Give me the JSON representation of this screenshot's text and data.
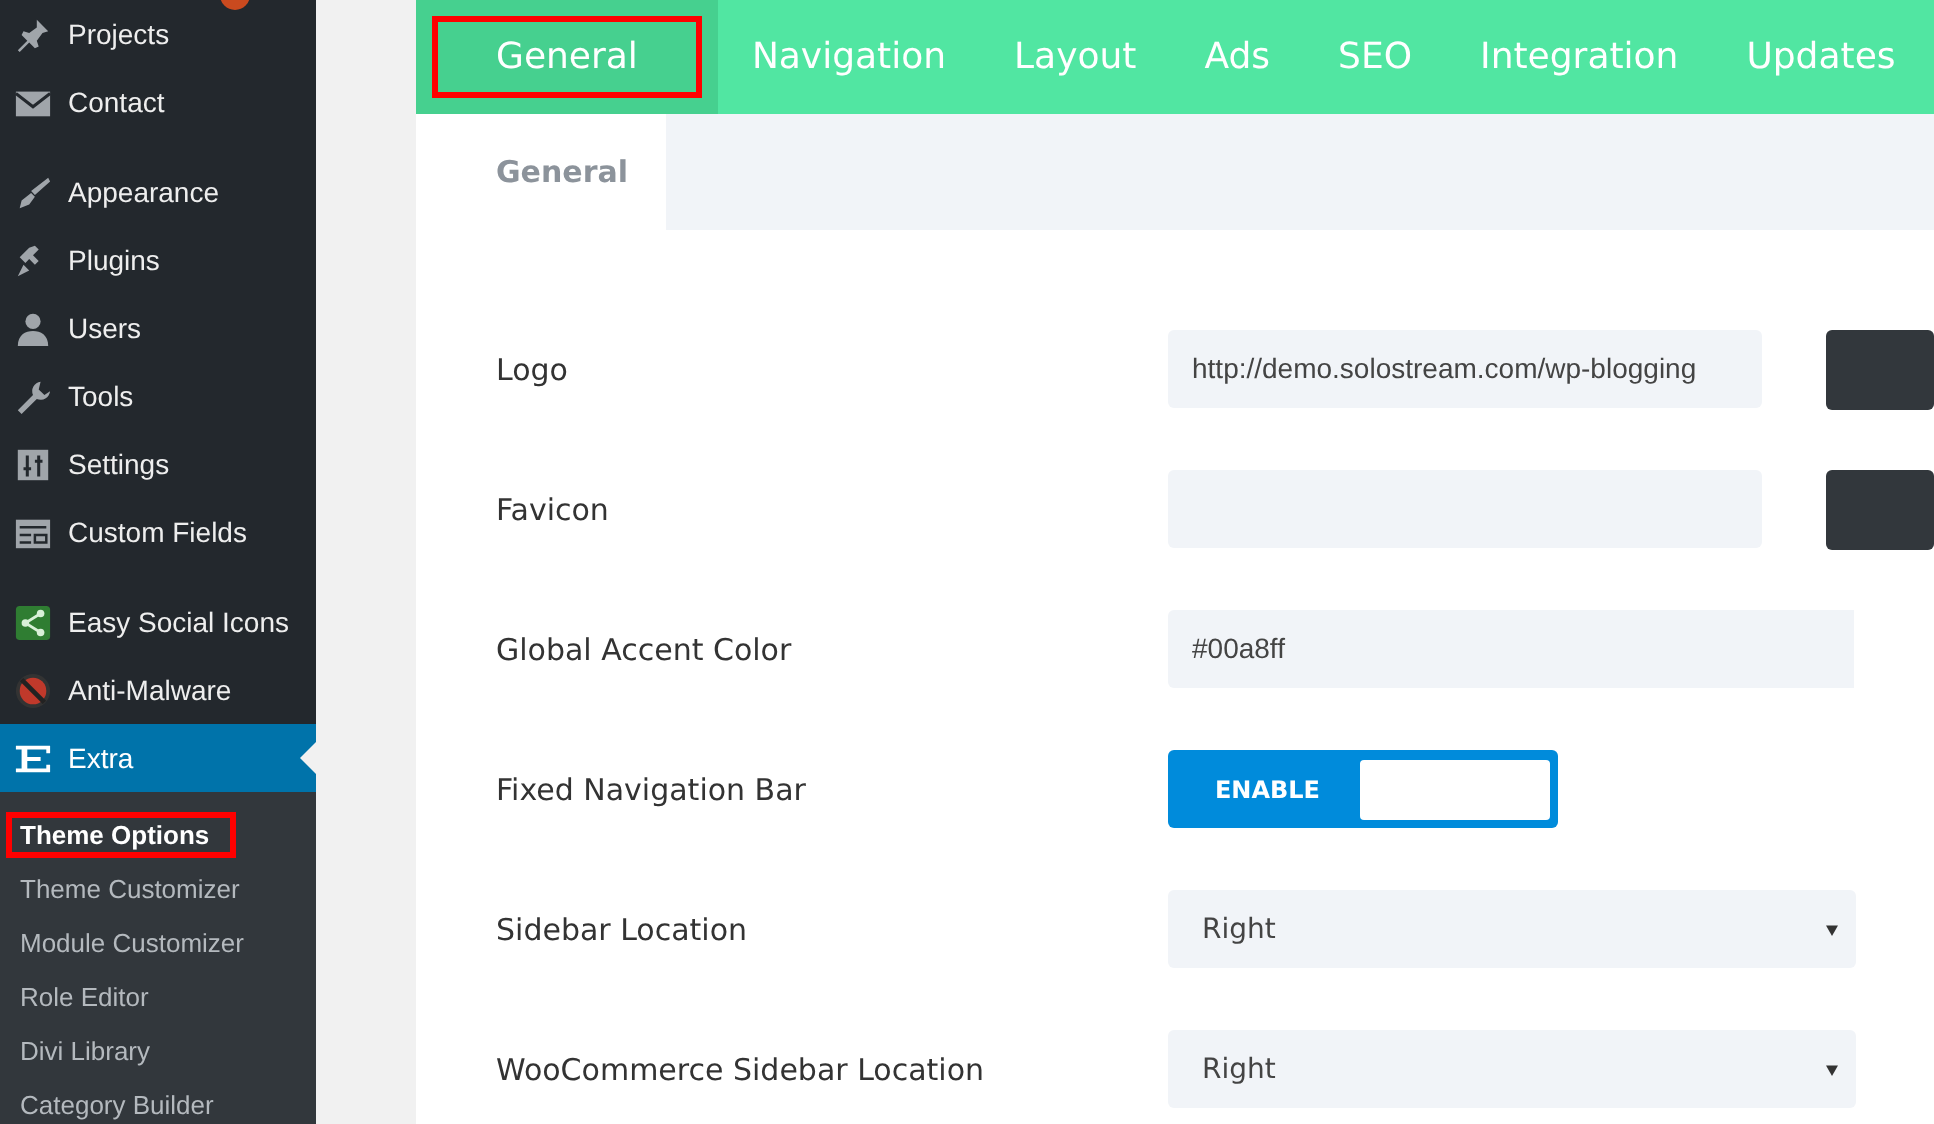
{
  "sidebar": {
    "badge": true,
    "groups": [
      {
        "items": [
          {
            "label": "Projects",
            "selected": false
          },
          {
            "label": "Contact",
            "selected": false
          }
        ]
      },
      {
        "items": [
          {
            "label": "Appearance",
            "selected": false
          },
          {
            "label": "Plugins",
            "selected": false
          },
          {
            "label": "Users",
            "selected": false
          },
          {
            "label": "Tools",
            "selected": false
          },
          {
            "label": "Settings",
            "selected": false
          },
          {
            "label": "Custom Fields",
            "selected": false
          }
        ]
      },
      {
        "items": [
          {
            "label": "Easy Social Icons",
            "selected": false
          },
          {
            "label": "Anti-Malware",
            "selected": false
          },
          {
            "label": "Extra",
            "selected": true,
            "children": [
              {
                "label": "Theme Options",
                "selected": true,
                "highlighted": true
              },
              {
                "label": "Theme Customizer",
                "selected": false,
                "highlighted": false
              },
              {
                "label": "Module Customizer",
                "selected": false,
                "highlighted": false
              },
              {
                "label": "Role Editor",
                "selected": false,
                "highlighted": false
              },
              {
                "label": "Divi Library",
                "selected": false,
                "highlighted": false
              },
              {
                "label": "Category Builder",
                "selected": false,
                "highlighted": false
              }
            ]
          }
        ]
      }
    ]
  },
  "tabs": [
    {
      "label": "General",
      "selected": true,
      "highlighted": true
    },
    {
      "label": "Navigation",
      "selected": false,
      "highlighted": false
    },
    {
      "label": "Layout",
      "selected": false,
      "highlighted": false
    },
    {
      "label": "Ads",
      "selected": false,
      "highlighted": false
    },
    {
      "label": "SEO",
      "selected": false,
      "highlighted": false
    },
    {
      "label": "Integration",
      "selected": false,
      "highlighted": false
    },
    {
      "label": "Updates",
      "selected": false,
      "highlighted": false
    }
  ],
  "subtabs": [
    {
      "label": "General",
      "selected": true
    }
  ],
  "settings": [
    {
      "kind": "upload",
      "label": "Logo",
      "value": "http://demo.solostream.com/wp-blogging"
    },
    {
      "kind": "upload",
      "label": "Favicon"
    },
    {
      "kind": "text",
      "label": "Global Accent Color",
      "value": "#00a8ff"
    },
    {
      "kind": "toggle",
      "label": "Fixed Navigation Bar",
      "state_label": "ENABLE",
      "on": true
    },
    {
      "kind": "select",
      "label": "Sidebar Location",
      "value": "Right"
    },
    {
      "kind": "select",
      "label": "WooCommerce Sidebar Location",
      "value": "Right"
    }
  ]
}
